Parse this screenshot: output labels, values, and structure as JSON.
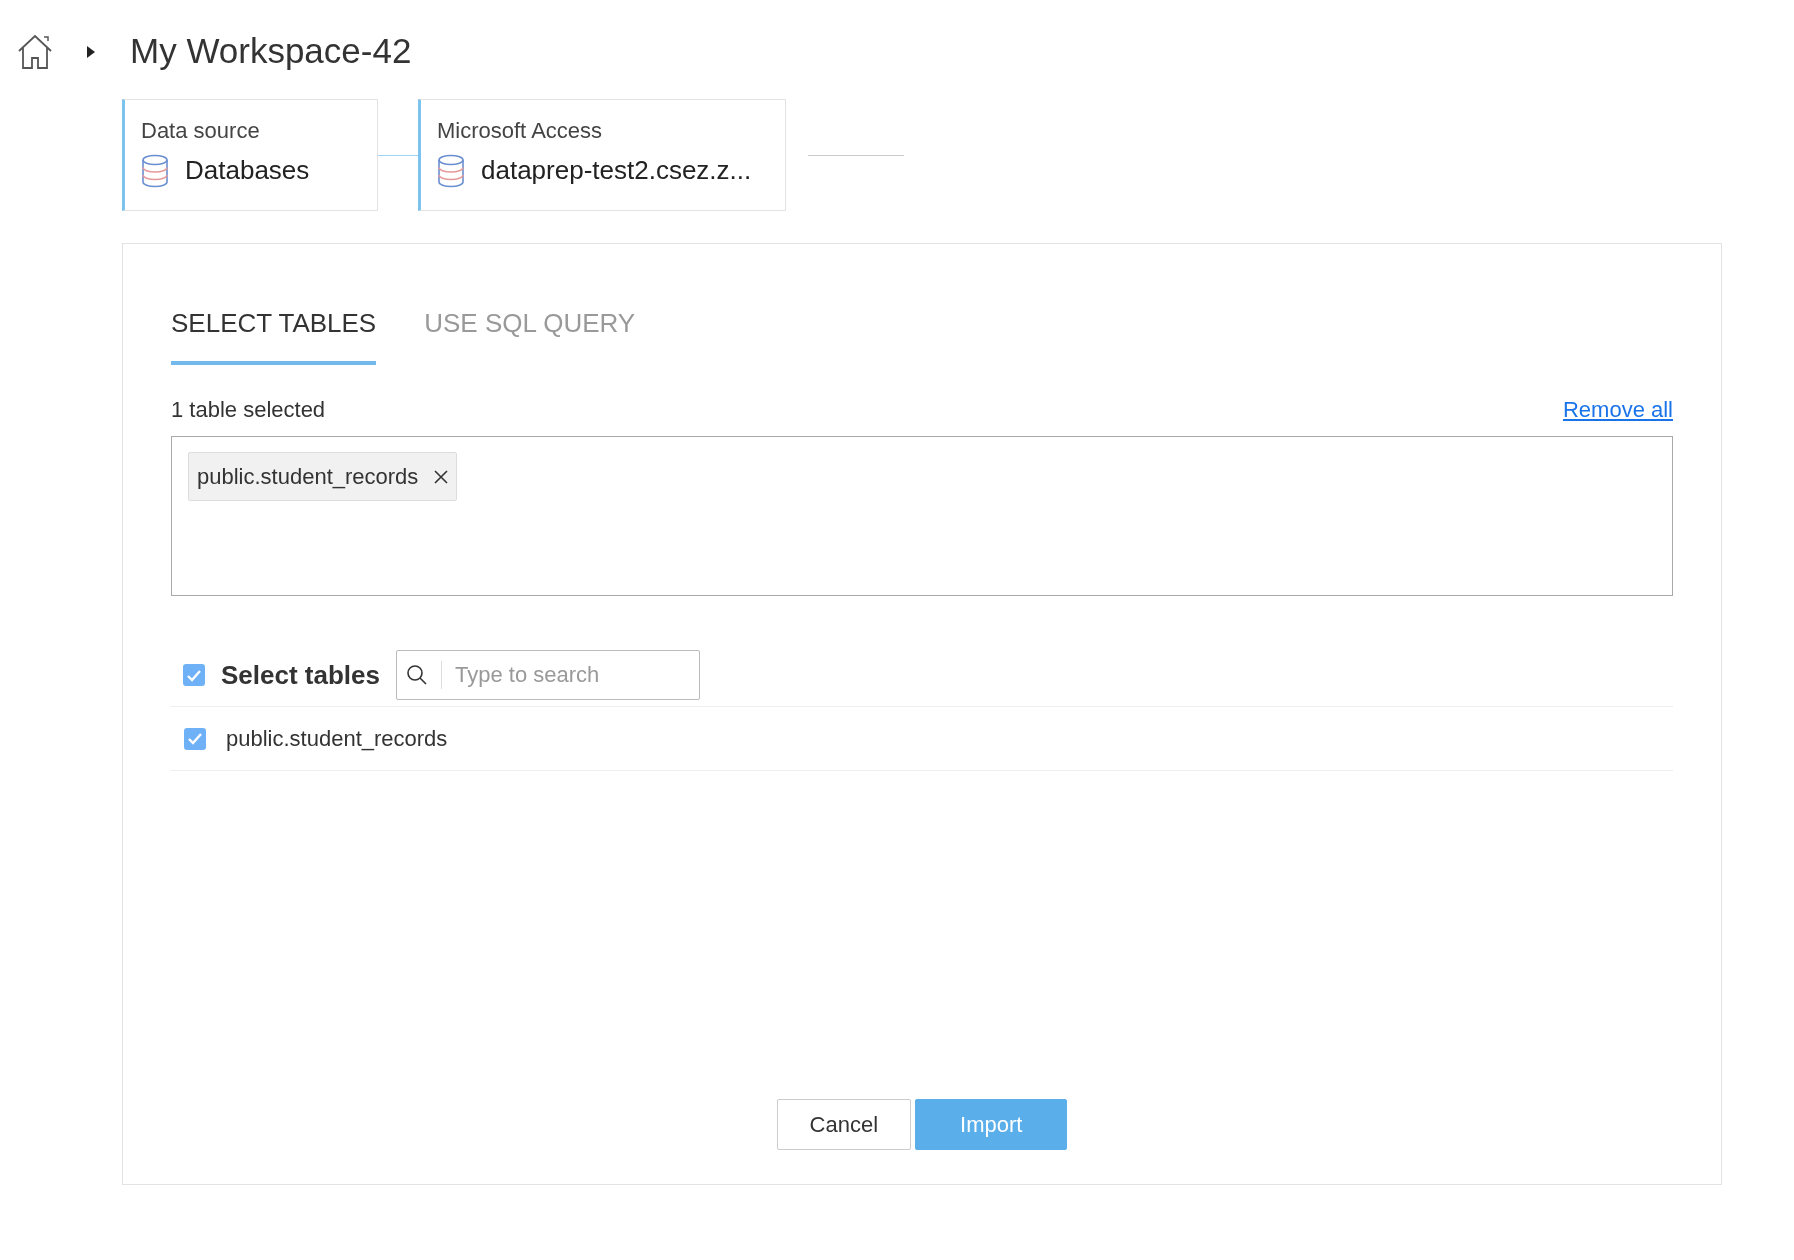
{
  "breadcrumb": {
    "title": "My Workspace-42"
  },
  "steps": [
    {
      "label": "Data source",
      "value": "Databases"
    },
    {
      "label": "Microsoft Access",
      "value": "dataprep-test2.csez.z..."
    }
  ],
  "tabs": [
    {
      "label": "SELECT TABLES",
      "selected": true
    },
    {
      "label": "USE SQL QUERY",
      "selected": false
    }
  ],
  "selection": {
    "count_text": "1 table selected",
    "remove_all": "Remove all",
    "chips": [
      "public.student_records"
    ]
  },
  "table_list": {
    "header": {
      "label": "Select tables",
      "checked": true
    },
    "search": {
      "placeholder": "Type to search"
    },
    "items": [
      {
        "name": "public.student_records",
        "checked": true
      }
    ]
  },
  "buttons": [
    {
      "label": "Cancel",
      "kind": "secondary"
    },
    {
      "label": "Import",
      "kind": "primary"
    }
  ]
}
